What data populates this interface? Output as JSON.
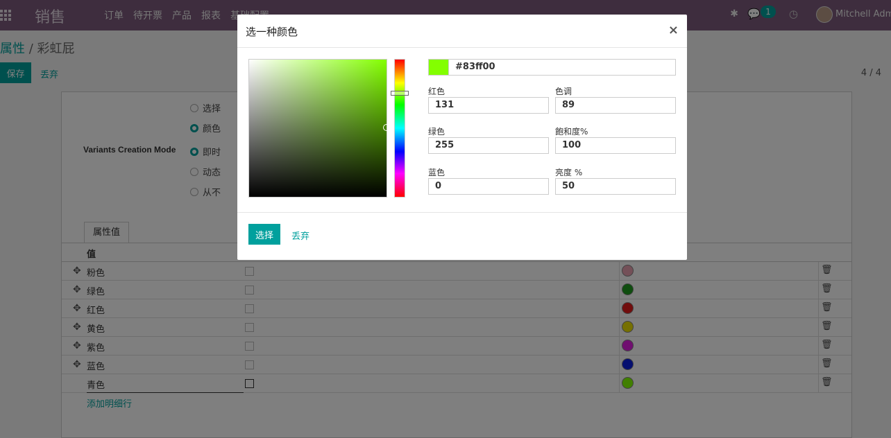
{
  "navbar": {
    "brand": "销售",
    "menu": [
      "订单",
      "待开票",
      "产品",
      "报表",
      "基础配置"
    ],
    "chat_count": "1",
    "user_name": "Mitchell Admin"
  },
  "breadcrumb": {
    "parent": "属性",
    "separator": " / ",
    "current": "彩虹屁"
  },
  "control": {
    "save_label": "保存",
    "discard_label": "丢弃",
    "pager": "4 / 4"
  },
  "form": {
    "display_type_options": [
      "选择",
      "颜色"
    ],
    "display_type_selected": "颜色",
    "variants_mode_label": "Variants Creation Mode",
    "variants_mode_options": [
      "即时",
      "动态",
      "从不"
    ],
    "variants_mode_selected": "即时",
    "tab_label": "属性值",
    "column_value": "值",
    "rows": [
      {
        "name": "粉色",
        "color": "#e8a0b0"
      },
      {
        "name": "绿色",
        "color": "#1e9a1e"
      },
      {
        "name": "红色",
        "color": "#e31b1b"
      },
      {
        "name": "黄色",
        "color": "#ede000"
      },
      {
        "name": "紫色",
        "color": "#e01ee0"
      },
      {
        "name": "蓝色",
        "color": "#0a1ee0"
      },
      {
        "name": "青色",
        "color": "#83ff00"
      }
    ],
    "add_line_label": "添加明细行"
  },
  "modal": {
    "title": "选一种颜色",
    "close": "×",
    "hex": "#83ff00",
    "red_label": "红色",
    "red": "131",
    "green_label": "绿色",
    "green": "255",
    "blue_label": "蓝色",
    "blue": "0",
    "hue_label": "色调",
    "hue": "89",
    "saturation_label": "飽和度%",
    "saturation": "100",
    "lightness_label": "亮度 %",
    "lightness": "50",
    "select_label": "选择",
    "cancel_label": "丢弃",
    "selected_color": "#83ff00"
  }
}
